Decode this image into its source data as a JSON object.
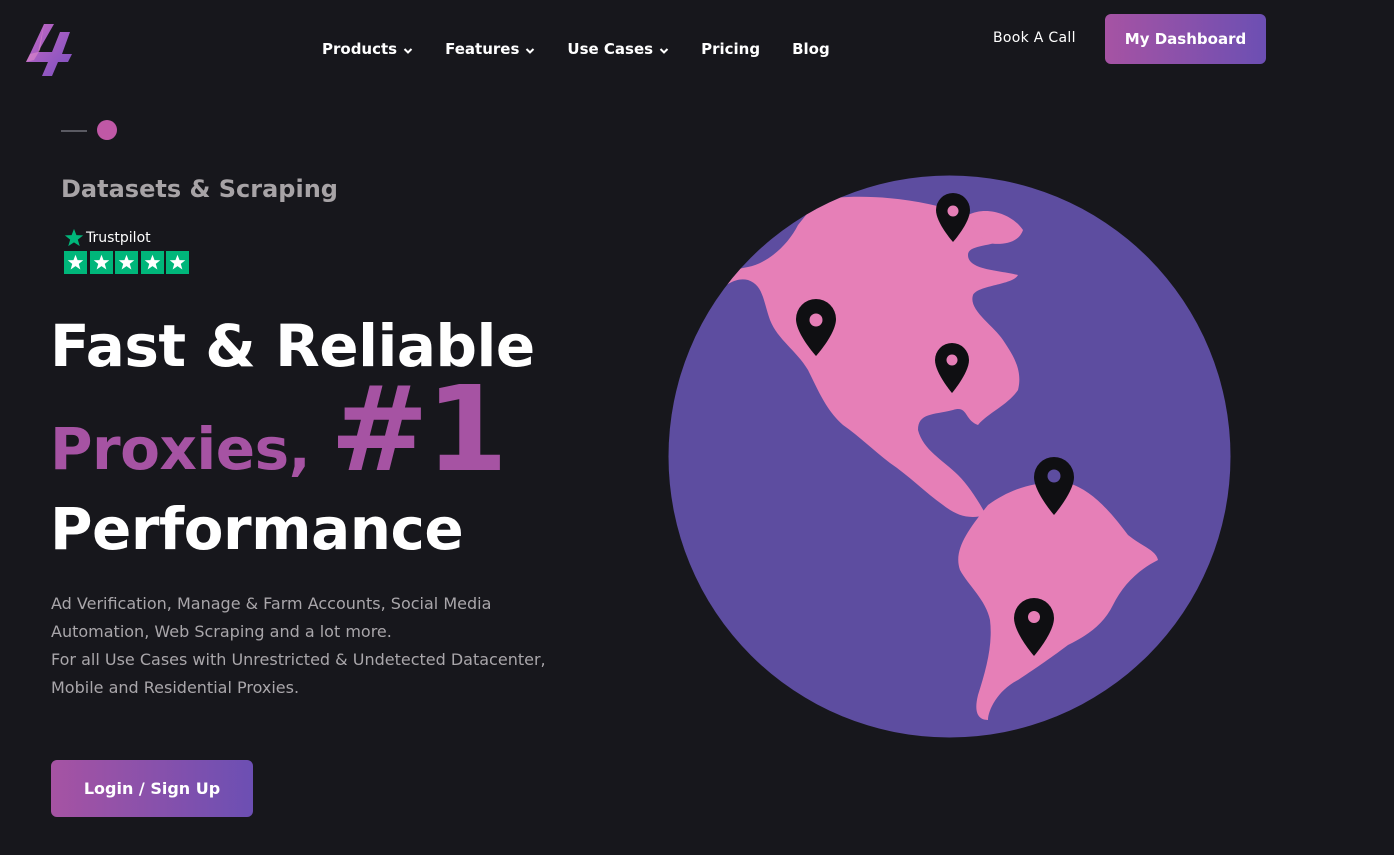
{
  "header": {
    "nav": [
      {
        "label": "Products",
        "dropdown": true
      },
      {
        "label": "Features",
        "dropdown": true
      },
      {
        "label": "Use Cases",
        "dropdown": true
      },
      {
        "label": "Pricing",
        "dropdown": false
      },
      {
        "label": "Blog",
        "dropdown": false
      }
    ],
    "book_call": "Book A Call",
    "dashboard_button": "My Dashboard"
  },
  "hero": {
    "slide_title": "Datasets & Scraping",
    "trustpilot": {
      "label": "Trustpilot",
      "stars": 5
    },
    "headline_line1": "Fast & Reliable",
    "headline_proxies": "Proxies,",
    "headline_rank": "#1",
    "headline_line3": "Performance",
    "description": [
      "Ad Verification, Manage & Farm Accounts, Social Media",
      "Automation, Web Scraping and a lot more.",
      "For all Use Cases with Unrestricted & Undetected Datacenter,",
      "Mobile and Residential Proxies."
    ],
    "login_button": "Login / Sign Up"
  },
  "colors": {
    "background": "#17171c",
    "accent": "#a653a3",
    "gradient_end": "#6c4fb3",
    "globe_ocean": "#5d4da0",
    "globe_land": "#e67fb7",
    "trustpilot_green": "#00b67a"
  },
  "icons": [
    "logo-icon",
    "chevron-down-icon",
    "trustpilot-star-icon",
    "globe-illustration",
    "map-pin-icon"
  ]
}
